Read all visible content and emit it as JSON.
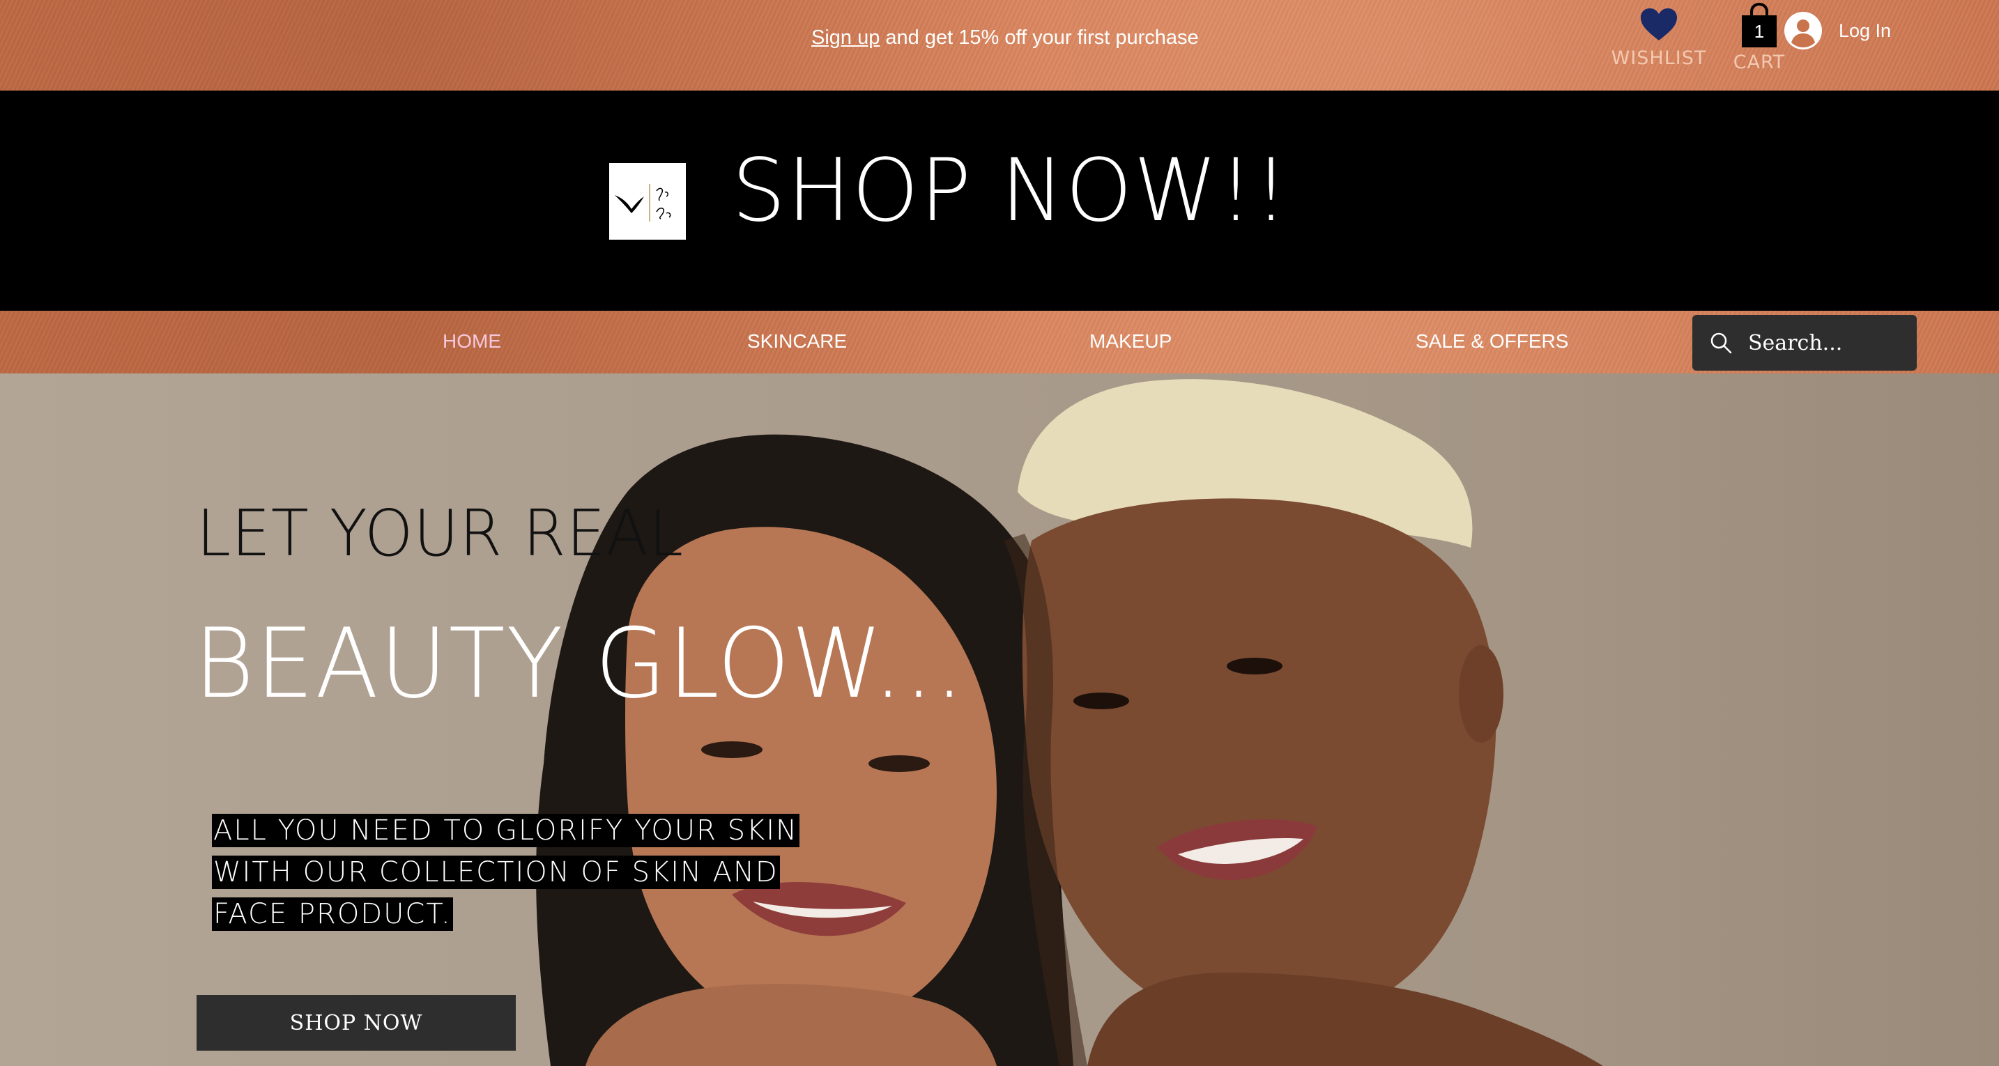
{
  "promo": {
    "signup_link": "Sign up",
    "message": " and get 15% off your first purchase"
  },
  "header_actions": {
    "wishlist_label": "WISHLIST",
    "cart_label": "CART",
    "cart_count": "1",
    "login_label": "Log In"
  },
  "brand": {
    "title": "SHOP NOW!!"
  },
  "nav": {
    "items": [
      {
        "label": "HOME"
      },
      {
        "label": "SKINCARE"
      },
      {
        "label": "MAKEUP"
      },
      {
        "label": "SALE & OFFERS"
      }
    ],
    "active_index": 0,
    "search_placeholder": "Search..."
  },
  "hero": {
    "kicker": "LET YOUR REAL",
    "headline": "BEAUTY GLOW...",
    "tagline_lines": [
      " ALL YOU NEED TO GLORIFY YOUR SKIN",
      "WITH OUR COLLECTION OF SKIN AND",
      "FACE PRODUCT."
    ],
    "cta_label": "SHOP NOW"
  },
  "colors": {
    "promo_bar": "#d47d56",
    "header_bg": "#000000",
    "nav_active": "#f7c8dd",
    "wishlist_heart": "#1a2a66",
    "button_bg": "#2e2e2e"
  },
  "icons": [
    "heart-icon",
    "shopping-bag-icon",
    "user-avatar-icon",
    "search-icon"
  ]
}
